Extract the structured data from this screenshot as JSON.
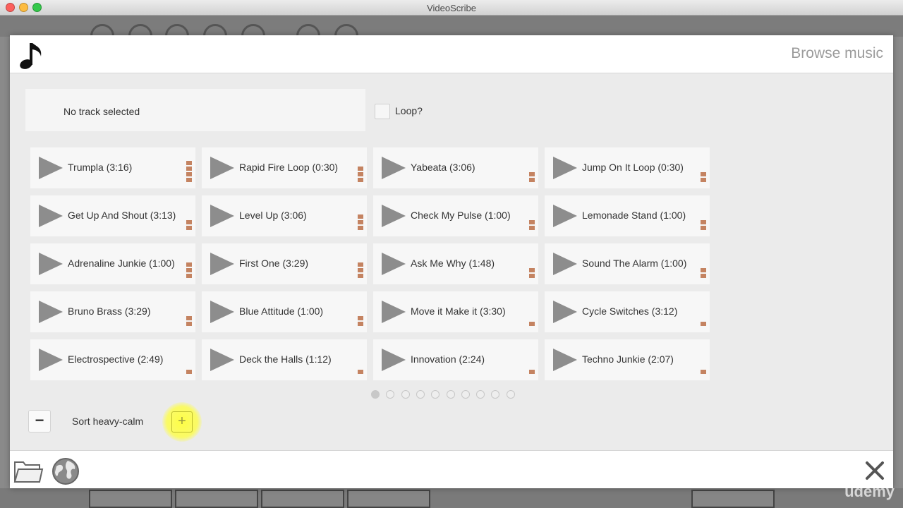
{
  "window": {
    "title": "VideoScribe"
  },
  "dialog": {
    "title": "Browse music",
    "track_status": "No track selected",
    "loop_label": "Loop?",
    "sort_label": "Sort heavy-calm",
    "minus_label": "−",
    "plus_label": "+"
  },
  "tracks": [
    [
      "Trumpla (3:16)",
      "Rapid Fire Loop (0:30)",
      "Yabeata (3:06)",
      "Jump On It Loop (0:30)"
    ],
    [
      "Get Up And Shout (3:13)",
      "Level Up (3:06)",
      "Check My Pulse (1:00)",
      "Lemonade Stand (1:00)"
    ],
    [
      "Adrenaline Junkie (1:00)",
      "First One (3:29)",
      "Ask Me Why (1:48)",
      "Sound The Alarm (1:00)"
    ],
    [
      "Bruno Brass (3:29)",
      "Blue Attitude (1:00)",
      "Move it Make it (3:30)",
      "Cycle Switches (3:12)"
    ],
    [
      "Electrospective (2:49)",
      "Deck the Halls (1:12)",
      "Innovation (2:24)",
      "Techno Junkie (2:07)"
    ]
  ],
  "intensity_levels": [
    [
      4,
      3,
      2,
      2
    ],
    [
      2,
      3,
      2,
      2
    ],
    [
      3,
      3,
      2,
      2
    ],
    [
      2,
      2,
      1,
      1
    ],
    [
      1,
      1,
      1,
      1
    ]
  ],
  "pagination": {
    "pages": 10,
    "current": 1
  },
  "colors": {
    "intensity_bar": "#c48361",
    "play_icon": "#8d8d8d",
    "highlight": "#ffff3c"
  },
  "icons": {
    "music": "music-note-icon",
    "folder": "folder-icon",
    "globe": "globe-icon",
    "close": "close-icon",
    "play": "play-icon",
    "intensity": "intensity-bars-icon"
  },
  "watermark": "udemy"
}
